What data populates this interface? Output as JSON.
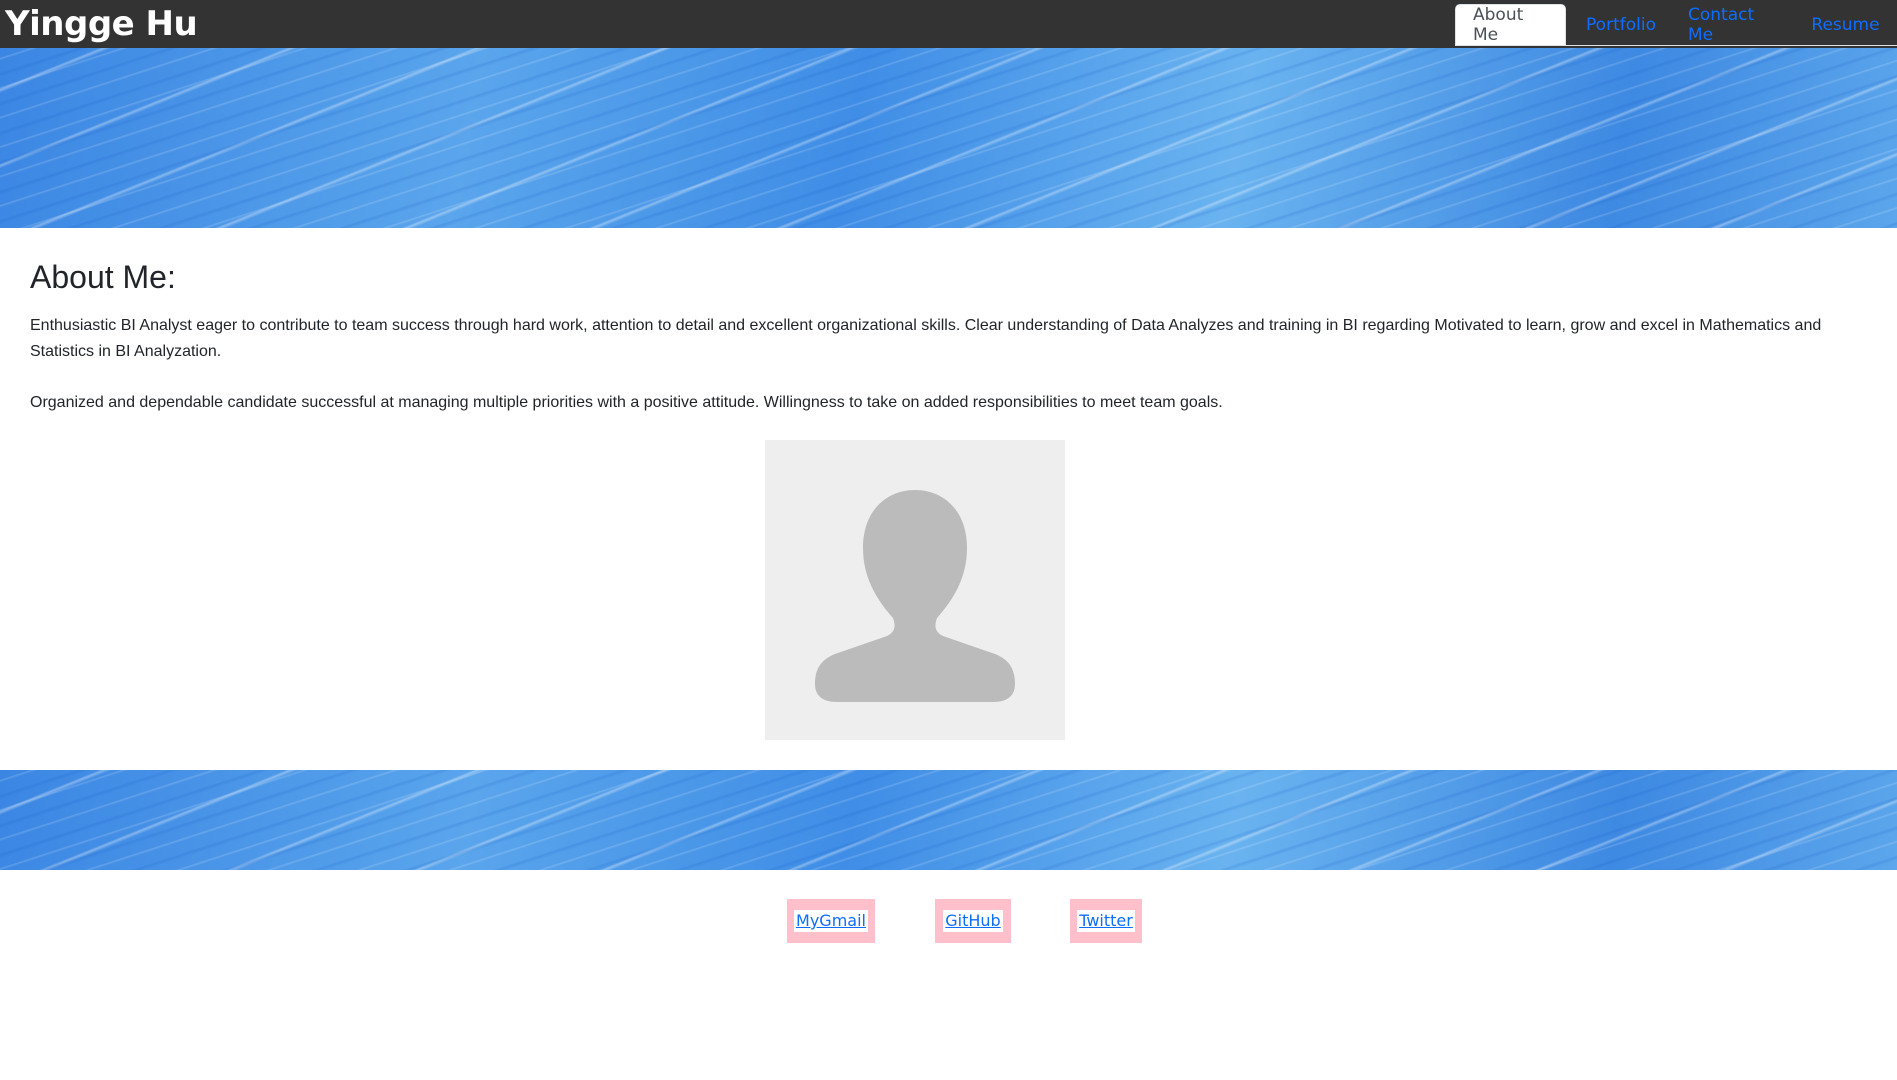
{
  "header": {
    "brand": "Yingge Hu",
    "tabs": [
      {
        "label": "About Me",
        "active": true
      },
      {
        "label": "Portfolio",
        "active": false
      },
      {
        "label": "Contact Me",
        "active": false
      },
      {
        "label": "Resume",
        "active": false
      }
    ]
  },
  "main": {
    "heading": "About Me:",
    "paragraphs": [
      "Enthusiastic BI Analyst eager to contribute to team success through hard work, attention to detail and excellent organizational skills. Clear understanding of Data Analyzes and training in BI regarding Motivated to learn, grow and excel in Mathematics and Statistics in BI Analyzation.",
      "Organized and dependable candidate successful at managing multiple priorities with a positive attitude. Willingness to take on added responsibilities to meet team goals."
    ],
    "avatar_icon": "user-silhouette-icon"
  },
  "footer": {
    "links": [
      {
        "label": "MyGmail"
      },
      {
        "label": "GitHub"
      },
      {
        "label": "Twitter"
      }
    ]
  },
  "colors": {
    "navbar_bg": "#333333",
    "link": "#0d6efd",
    "footer_link_bg": "#ffc0cb",
    "avatar_bg": "#eeeeee",
    "avatar_fg": "#bbbbbb"
  }
}
